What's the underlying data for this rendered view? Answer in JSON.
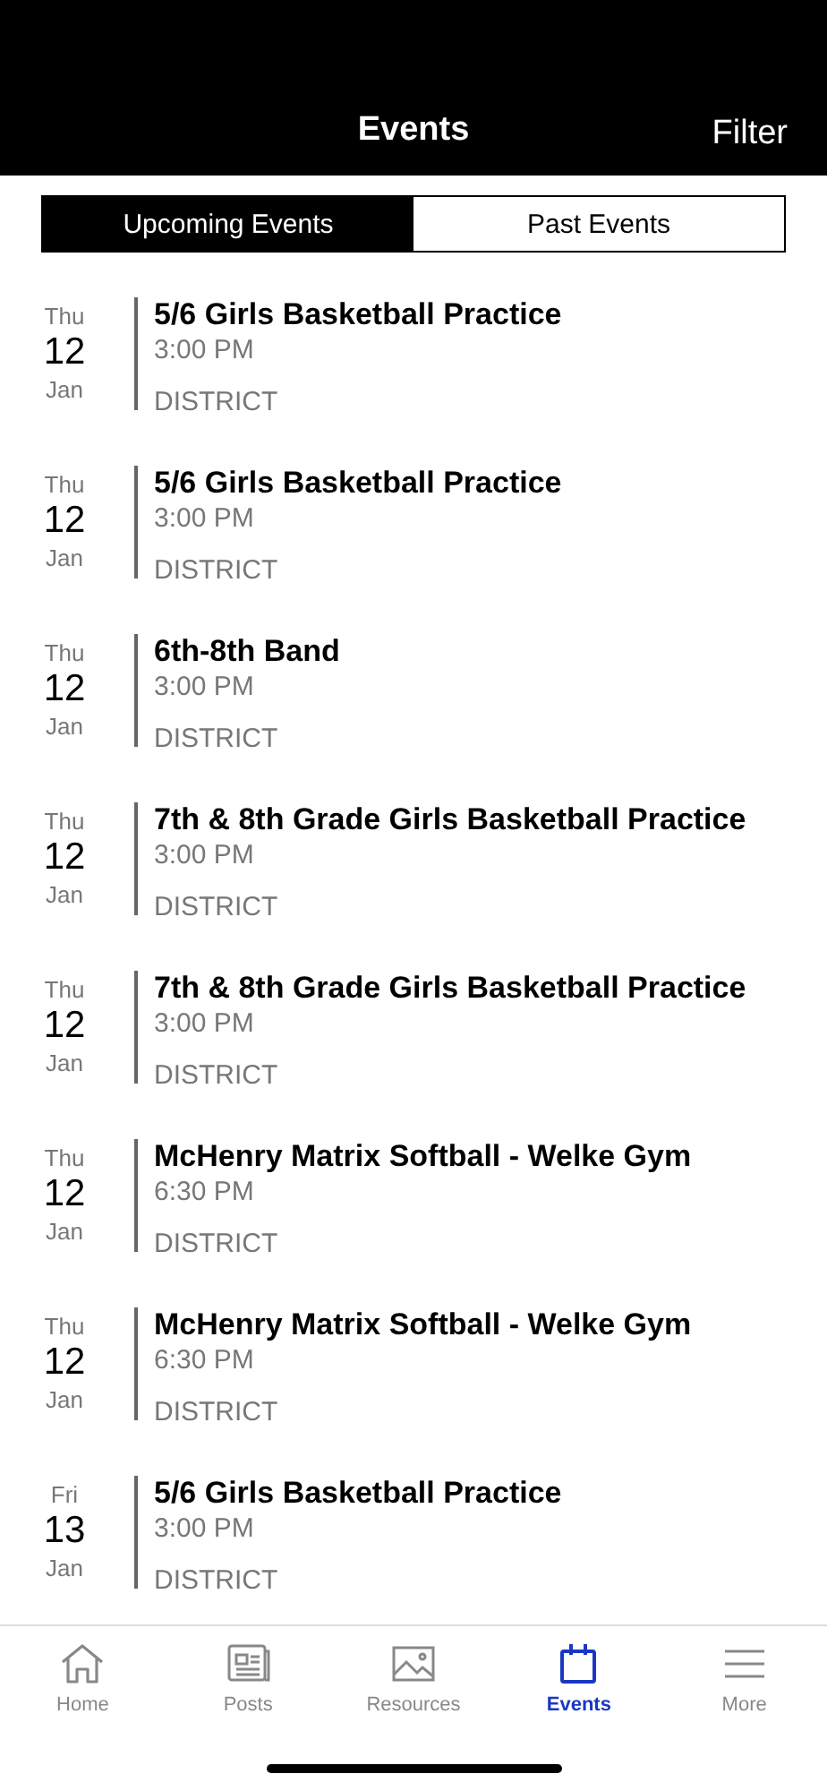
{
  "header": {
    "title": "Events",
    "filter": "Filter"
  },
  "segments": [
    {
      "label": "Upcoming Events",
      "selected": true
    },
    {
      "label": "Past Events",
      "selected": false
    }
  ],
  "events": [
    {
      "weekday": "Thu",
      "day": "12",
      "month": "Jan",
      "title": "5/6 Girls Basketball Practice",
      "time": "3:00 PM",
      "location": "DISTRICT"
    },
    {
      "weekday": "Thu",
      "day": "12",
      "month": "Jan",
      "title": "5/6 Girls Basketball Practice",
      "time": "3:00 PM",
      "location": "DISTRICT"
    },
    {
      "weekday": "Thu",
      "day": "12",
      "month": "Jan",
      "title": "6th-8th Band",
      "time": "3:00 PM",
      "location": "DISTRICT"
    },
    {
      "weekday": "Thu",
      "day": "12",
      "month": "Jan",
      "title": "7th & 8th Grade Girls Basketball Practice",
      "time": "3:00 PM",
      "location": "DISTRICT"
    },
    {
      "weekday": "Thu",
      "day": "12",
      "month": "Jan",
      "title": "7th & 8th Grade Girls Basketball Practice",
      "time": "3:00 PM",
      "location": "DISTRICT"
    },
    {
      "weekday": "Thu",
      "day": "12",
      "month": "Jan",
      "title": "McHenry Matrix Softball - Welke Gym",
      "time": "6:30 PM",
      "location": "DISTRICT"
    },
    {
      "weekday": "Thu",
      "day": "12",
      "month": "Jan",
      "title": "McHenry Matrix Softball - Welke Gym",
      "time": "6:30 PM",
      "location": "DISTRICT"
    },
    {
      "weekday": "Fri",
      "day": "13",
      "month": "Jan",
      "title": "5/6 Girls Basketball Practice",
      "time": "3:00 PM",
      "location": "DISTRICT"
    }
  ],
  "tabs": [
    {
      "kind": "home",
      "label": "Home",
      "selected": false
    },
    {
      "kind": "posts",
      "label": "Posts",
      "selected": false
    },
    {
      "kind": "resources",
      "label": "Resources",
      "selected": false
    },
    {
      "kind": "events",
      "label": "Events",
      "selected": true
    },
    {
      "kind": "more",
      "label": "More",
      "selected": false
    }
  ]
}
